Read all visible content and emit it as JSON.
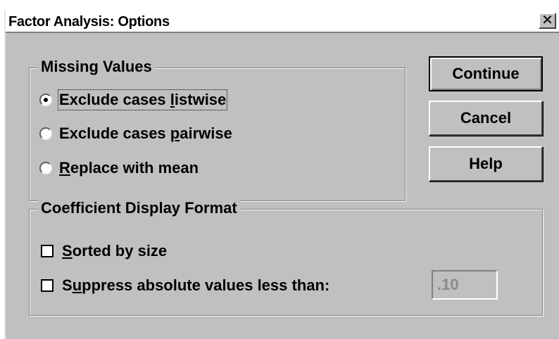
{
  "window": {
    "title": "Factor Analysis: Options",
    "close_glyph": "✕"
  },
  "missing_values": {
    "legend": "Missing Values",
    "options": [
      {
        "pre": "Exclude cases ",
        "u": "l",
        "post": "istwise",
        "selected": true
      },
      {
        "pre": "Exclude cases ",
        "u": "p",
        "post": "airwise",
        "selected": false
      },
      {
        "pre": "",
        "u": "R",
        "post": "eplace with mean",
        "selected": false
      }
    ]
  },
  "coefficient_display": {
    "legend": "Coefficient Display Format",
    "options": [
      {
        "pre": "",
        "u": "S",
        "post": "orted by size",
        "checked": false
      },
      {
        "pre": "S",
        "u": "u",
        "post": "ppress absolute values less than:",
        "checked": false
      }
    ],
    "suppress_value": ".10"
  },
  "buttons": {
    "continue": "Continue",
    "cancel": "Cancel",
    "help": "Help"
  }
}
